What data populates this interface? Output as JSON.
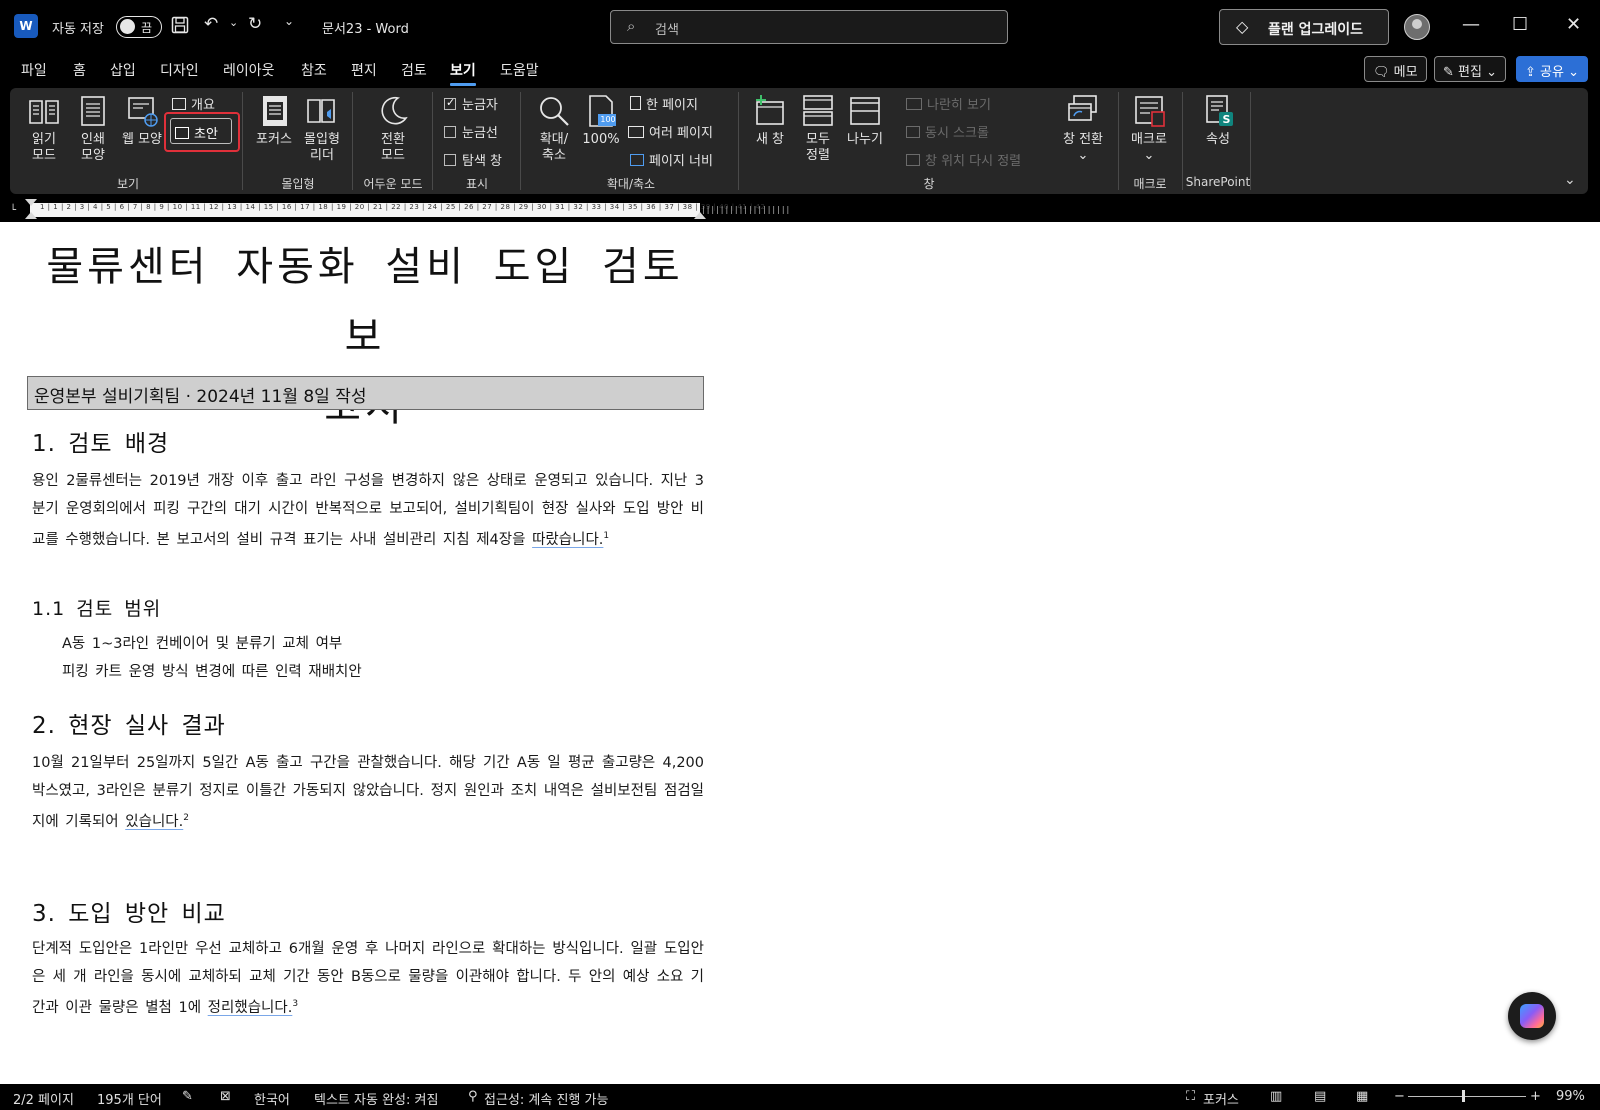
{
  "titlebar": {
    "app_icon": "word-icon",
    "autosave_label": "자동 저장",
    "autosave_state": "끔",
    "doc_title": "문서23  -  Word",
    "search_placeholder": "검색",
    "upgrade_label": "플랜 업그레이드",
    "window_controls": [
      "minimize-icon",
      "maximize-icon",
      "close-icon"
    ]
  },
  "menu": {
    "tabs": [
      "파일",
      "홈",
      "삽입",
      "디자인",
      "레이아웃",
      "참조",
      "편지",
      "검토",
      "보기",
      "도움말"
    ],
    "active_tab": "보기",
    "memo_label": "메모",
    "edit_label": "편집",
    "share_label": "공유"
  },
  "ribbon": {
    "view_group": {
      "label": "보기",
      "read_mode": "읽기\n모드",
      "print_layout": "인쇄\n모양",
      "web_layout": "웹 모양",
      "outline": "개요",
      "draft": "초안"
    },
    "immersive_group": {
      "label": "몰입형",
      "focus": "포커스",
      "immersive_reader": "몰입형\n리더"
    },
    "dark_group": {
      "label": "어두운 모드",
      "switch_mode": "전환\n모드"
    },
    "show_group": {
      "label": "표시",
      "ruler": "눈금자",
      "ruler_checked": true,
      "gridlines": "눈금선",
      "gridlines_checked": false,
      "nav_pane": "탐색 창",
      "nav_pane_checked": false
    },
    "zoom_group": {
      "label": "확대/축소",
      "zoom": "확대/\n축소",
      "hundred": "100%",
      "hundred_badge": "100",
      "one_page": "한 페이지",
      "multiple_pages": "여러 페이지",
      "page_width": "페이지 너비"
    },
    "window_group": {
      "label": "창",
      "new_window": "새 창",
      "arrange_all": "모두\n정렬",
      "split": "나누기",
      "side_by_side": "나란히 보기",
      "sync_scroll": "동시 스크롤",
      "reset_position": "창 위치 다시 정렬",
      "switch_windows": "창 전환"
    },
    "macro_group": {
      "label": "매크로",
      "macros": "매크로"
    },
    "sharepoint_group": {
      "label": "SharePoint",
      "properties": "속성"
    }
  },
  "ruler": {
    "numbers": "1 | 1 | 2 | 3 | 4 | 5 | 6 | 7 | 8 | 9 | 10 | 11 | 12 | 13 | 14 | 15 | 16 | 17 | 18 | 19 | 20 | 21 | 22 | 23 | 24 | 25 | 26 | 27 | 28 | 29 | 30 | 31 | 32 | 33 | 34 | 35 | 36 | 37 | 38 | 39 | 40 | 41 | 42"
  },
  "document": {
    "title_line1": "물류센터 자동화 설비 도입 검토 보",
    "title_line2": "고서",
    "subtitle": "운영본부 설비기획팀 · 2024년 11월 8일 작성",
    "s1_heading": "1. 검토 배경",
    "s1_para": "용인 2물류센터는 2019년 개장 이후 출고 라인 구성을 변경하지 않은 상태로 운영되고 있습니다. 지난 3분기 운영회의에서 피킹 구간의 대기 시간이 반복적으로 보고되어, 설비기획팀이 현장 실사와 도입 방안 비교를 수행했습니다. 본 보고서의 설비 규격 표기는 사내 설비관리 지침 제4장을",
    "s1_para_end": "따랐습니다.",
    "s1_fn": "1",
    "s11_heading": "1.1 검토 범위",
    "s11_bullet1": "A동 1~3라인 컨베이어 및 분류기 교체 여부",
    "s11_bullet2": "피킹 카트 운영 방식 변경에 따른 인력 재배치안",
    "s2_heading": "2. 현장 실사 결과",
    "s2_para": "10월 21일부터 25일까지 5일간 A동 출고 구간을 관찰했습니다. 해당 기간 A동 일 평균 출고량은 4,200박스였고, 3라인은 분류기 정지로 이틀간 가동되지 않았습니다. 정지 원인과 조치 내역은 설비보전팀 점검일지에 기록되어",
    "s2_para_end": "있습니다.",
    "s2_fn": "2",
    "s3_heading": "3. 도입 방안 비교",
    "s3_para": "단계적 도입안은 1라인만 우선 교체하고 6개월 운영 후 나머지 라인으로 확대하는 방식입니다. 일괄 도입안은 세 개 라인을 동시에 교체하되 교체 기간 동안 B동으로 물량을 이관해야 합니다. 두 안의 예상 소요 기간과 이관 물량은 별첨 1에",
    "s3_para_end": "정리했습니다.",
    "s3_fn": "3"
  },
  "statusbar": {
    "page": "2/2 페이지",
    "words": "195개 단어",
    "language": "한국어",
    "autocomplete": "텍스트 자동 완성: 켜짐",
    "accessibility": "접근성: 계속 진행 가능",
    "focus": "포커스",
    "zoom": "99%",
    "zoom_level_percent": 99
  },
  "colors": {
    "accent_blue": "#4f9cf0",
    "share_blue": "#2c6fd6",
    "draft_highlight": "#e0303a",
    "subtitle_bg": "#cfcfcf",
    "ribbon_bg": "#272727"
  }
}
